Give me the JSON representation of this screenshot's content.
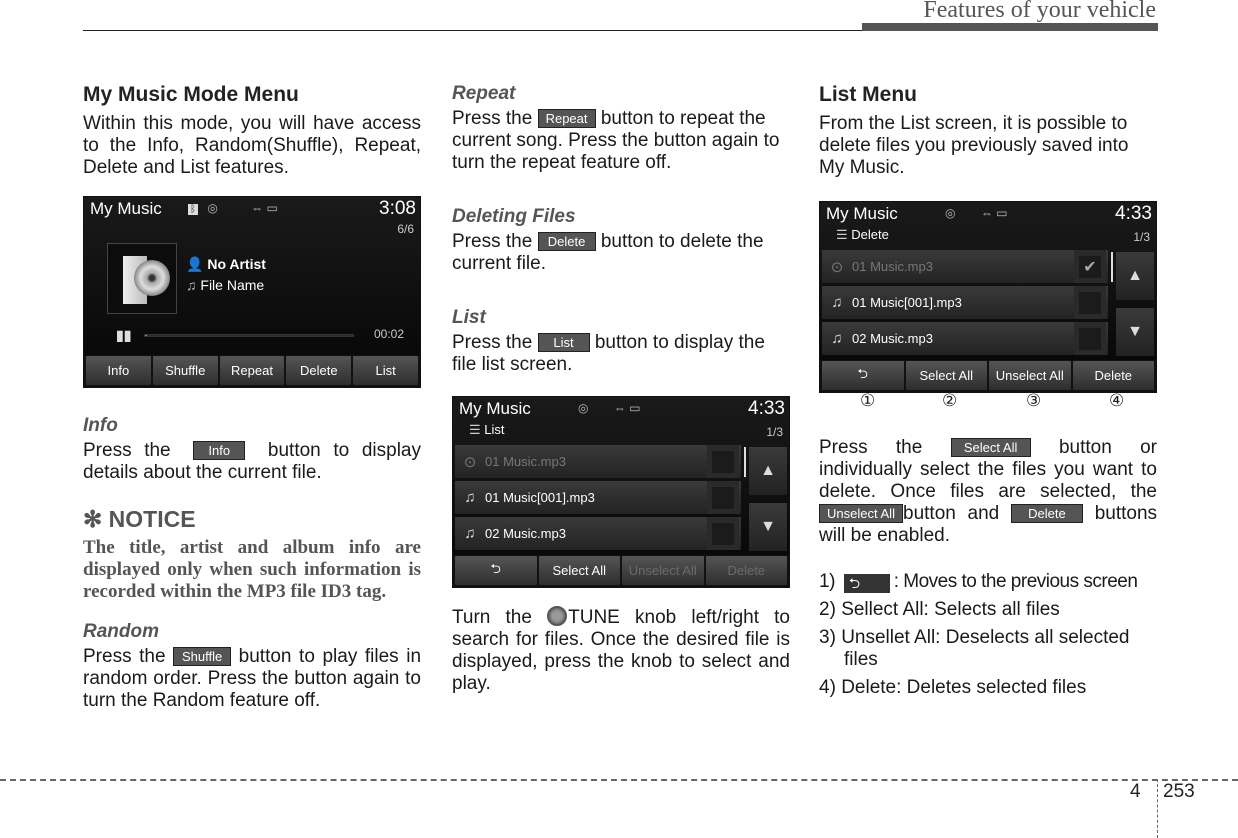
{
  "header": {
    "section_title": "Features of your vehicle"
  },
  "footer": {
    "chapter": "4",
    "page": "253"
  },
  "col1": {
    "heading": "My Music Mode Menu",
    "intro": "Within this mode, you will have access to the Info, Random(Shuffle), Repeat, Delete and List features.",
    "screen_player": {
      "title": "My Music",
      "icons": [
        "bluetooth-icon",
        "disc-icon",
        "usb-icon",
        "ipod-icon"
      ],
      "time": "3:08",
      "track_count": "6/6",
      "artist": "No Artist",
      "file_name": "File Name",
      "elapsed": "00:02",
      "progress_percent": 1,
      "buttons": [
        "Info",
        "Shuffle",
        "Repeat",
        "Delete",
        "List"
      ]
    },
    "info": {
      "heading": "Info",
      "text_before": "Press the",
      "chip": "Info",
      "text_after": "button to display details about the current file."
    },
    "notice": {
      "symbol": "✻",
      "heading": "NOTICE",
      "text": "The title, artist and album info are displayed only when such information is recorded within the MP3 file ID3 tag."
    },
    "random": {
      "heading": "Random",
      "text_before": "Press the",
      "chip": "Shuffle",
      "text_after": "button to play files in random order. Press the button again to turn the Random feature off."
    }
  },
  "col2": {
    "repeat": {
      "heading": "Repeat",
      "text_before": "Press the",
      "chip": "Repeat",
      "text_after": "button to repeat the current song. Press the button again to turn the repeat feature off."
    },
    "deleting": {
      "heading": "Deleting Files",
      "text_before": "Press the",
      "chip": "Delete",
      "text_after": "button to delete the current file."
    },
    "list": {
      "heading": "List",
      "text_before": "Press the",
      "chip": "List",
      "text_after": "button to display the file list screen."
    },
    "screen_list": {
      "title": "My Music",
      "time": "4:33",
      "subtitle": "List",
      "page": "1/3",
      "rows": [
        {
          "name": "01 Music.mp3",
          "icon": "play-icon",
          "playing": true,
          "checked": false
        },
        {
          "name": "01 Music[001].mp3",
          "icon": "music-note-icon",
          "playing": false,
          "checked": false
        },
        {
          "name": "02 Music.mp3",
          "icon": "music-note-icon",
          "playing": false,
          "checked": false
        }
      ],
      "buttons": [
        {
          "label": "⮌",
          "enabled": true
        },
        {
          "label": "Select All",
          "enabled": true
        },
        {
          "label": "Unselect All",
          "enabled": false
        },
        {
          "label": "Delete",
          "enabled": false
        }
      ]
    },
    "tune": {
      "text_before": "Turn the",
      "knob_label": "TUNE",
      "text_after": "knob left/right to search for files. Once the desired file is displayed, press the knob to select and play."
    }
  },
  "col3": {
    "heading": "List Menu",
    "intro": "From the List screen, it is possible to delete files you previously saved into My Music.",
    "screen_delete": {
      "title": "My Music",
      "time": "4:33",
      "subtitle": "Delete",
      "page": "1/3",
      "rows": [
        {
          "name": "01 Music.mp3",
          "icon": "play-icon",
          "playing": true,
          "checked": true
        },
        {
          "name": "01 Music[001].mp3",
          "icon": "music-note-icon",
          "playing": false,
          "checked": false
        },
        {
          "name": "02 Music.mp3",
          "icon": "music-note-icon",
          "playing": false,
          "checked": false
        }
      ],
      "buttons": [
        {
          "label": "⮌",
          "enabled": true
        },
        {
          "label": "Select All",
          "enabled": true
        },
        {
          "label": "Unselect All",
          "enabled": true
        },
        {
          "label": "Delete",
          "enabled": true
        }
      ],
      "callouts": [
        "①",
        "②",
        "③",
        "④"
      ]
    },
    "select": {
      "t1": "Press the",
      "chip_select_all": "Select All",
      "t2": "button or individually select the files you want to delete. Once files are selected, the",
      "chip_unselect_all": "Unselect All",
      "t3": "button and",
      "chip_delete": "Delete",
      "t4": "buttons will be enabled."
    },
    "items": [
      {
        "num": "1)",
        "text": ": Moves to the previous screen",
        "back_chip": "⮌"
      },
      {
        "num": "2)",
        "text": "Sellect All: Selects all files"
      },
      {
        "num": "3)",
        "text": "Unsellet All: Deselects all selected files"
      },
      {
        "num": "4)",
        "text": "Delete: Deletes selected files"
      }
    ]
  }
}
